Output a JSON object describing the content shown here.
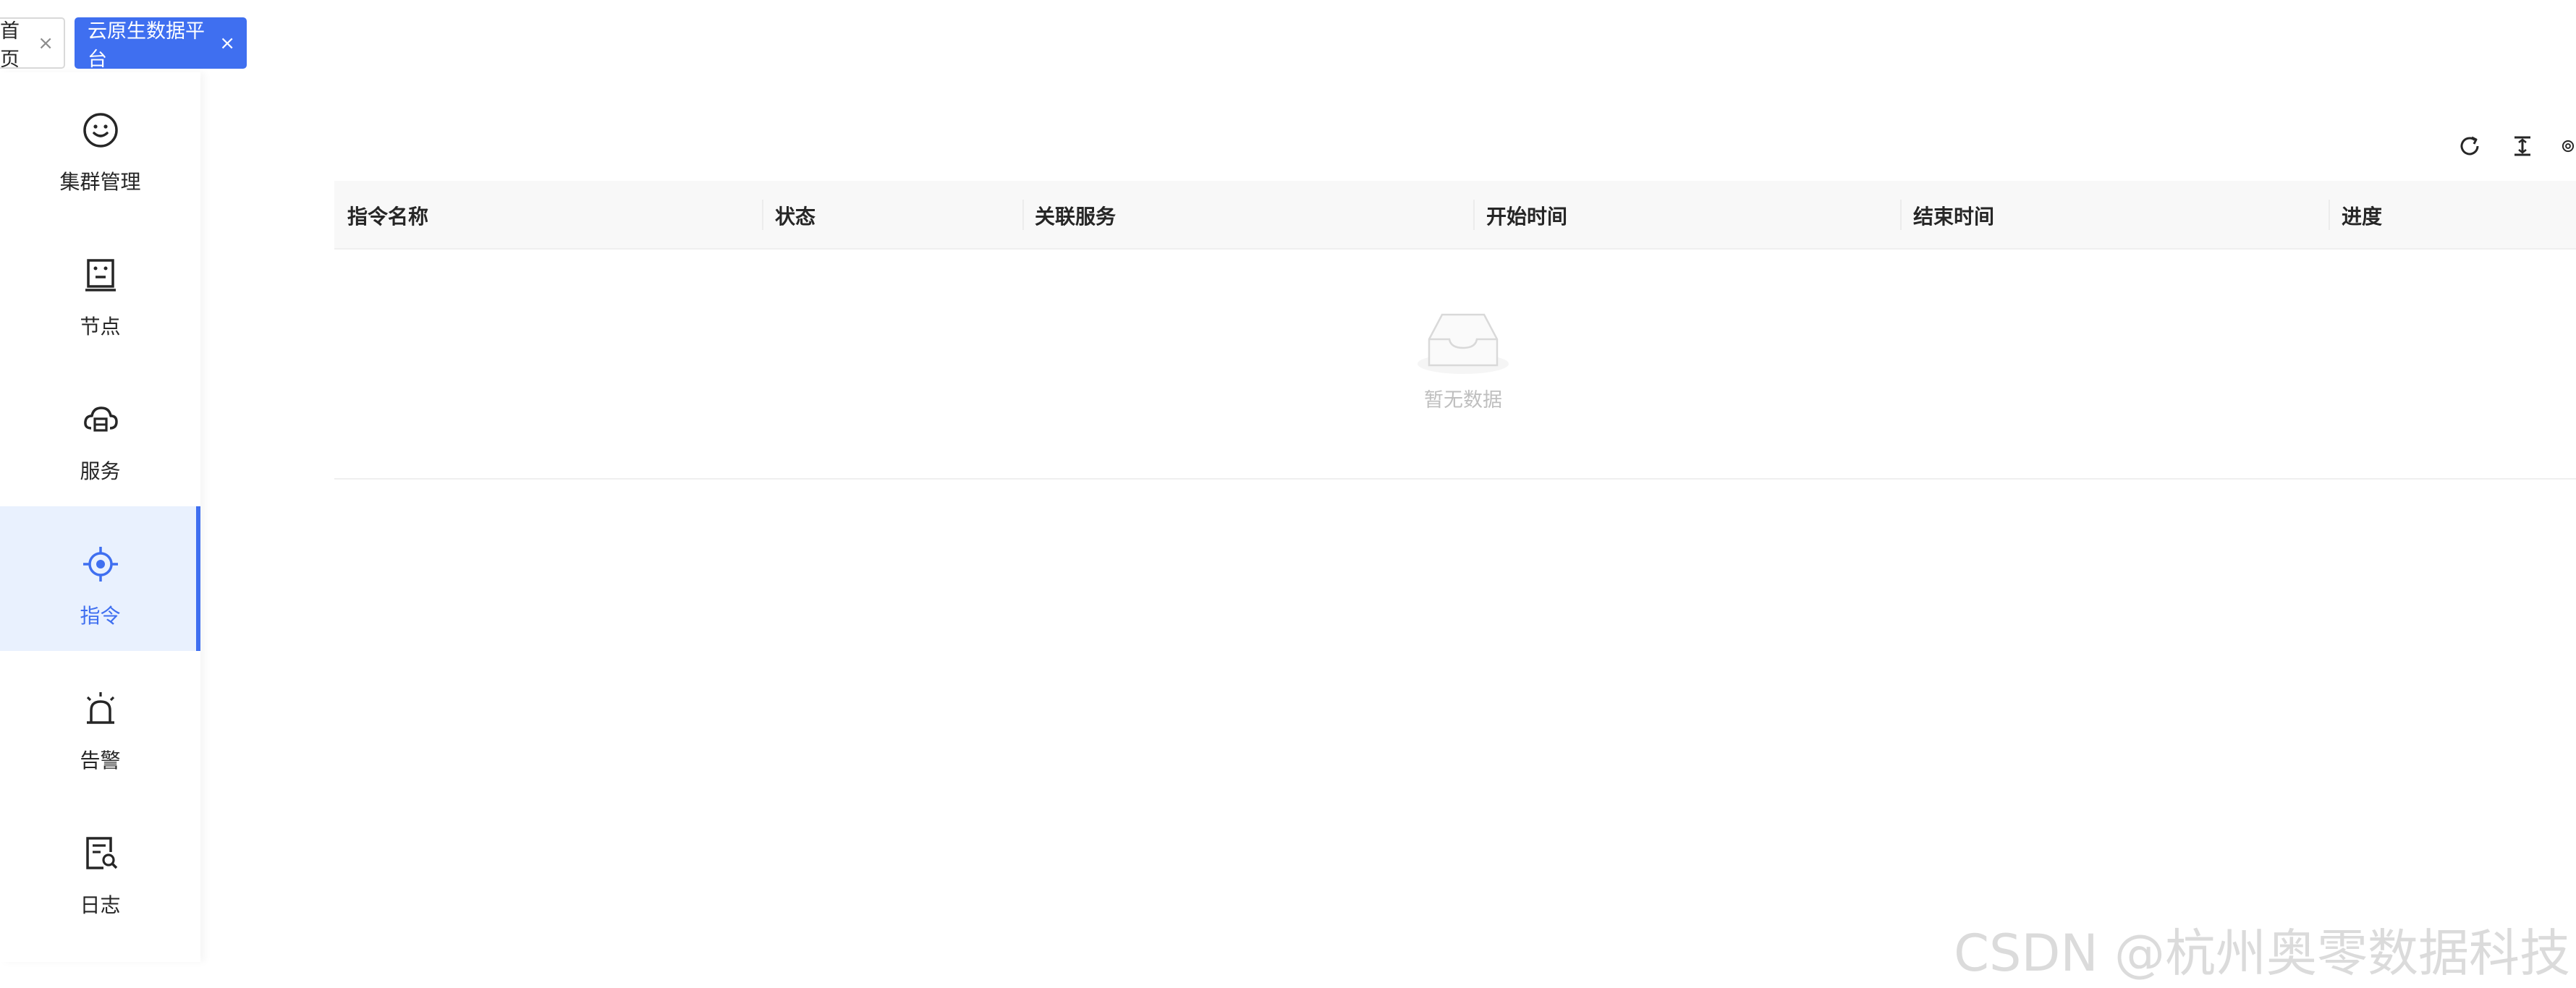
{
  "tabs": [
    {
      "label": "首页",
      "close": "×",
      "active": false
    },
    {
      "label": "云原生数据平台",
      "close": "×",
      "active": true
    }
  ],
  "sidebar": {
    "items": [
      {
        "label": "集群管理",
        "icon": "smile-icon",
        "active": false
      },
      {
        "label": "节点",
        "icon": "node-icon",
        "active": false
      },
      {
        "label": "服务",
        "icon": "cloud-service-icon",
        "active": false
      },
      {
        "label": "指令",
        "icon": "target-icon",
        "active": true
      },
      {
        "label": "告警",
        "icon": "alarm-icon",
        "active": false
      },
      {
        "label": "日志",
        "icon": "log-search-icon",
        "active": false
      }
    ]
  },
  "toolbar": {
    "icons": [
      "reload-icon",
      "column-height-icon",
      "setting-icon"
    ]
  },
  "table": {
    "columns": [
      "指令名称",
      "状态",
      "关联服务",
      "开始时间",
      "结束时间",
      "进度"
    ],
    "rows": [],
    "empty_text": "暂无数据"
  },
  "watermark": "CSDN @杭州奥零数据科技",
  "colors": {
    "accent": "#3f6ff0",
    "active_bg": "#e9f1fe",
    "header_bg": "#f8f8f8",
    "empty_text": "#bfbfbf"
  }
}
